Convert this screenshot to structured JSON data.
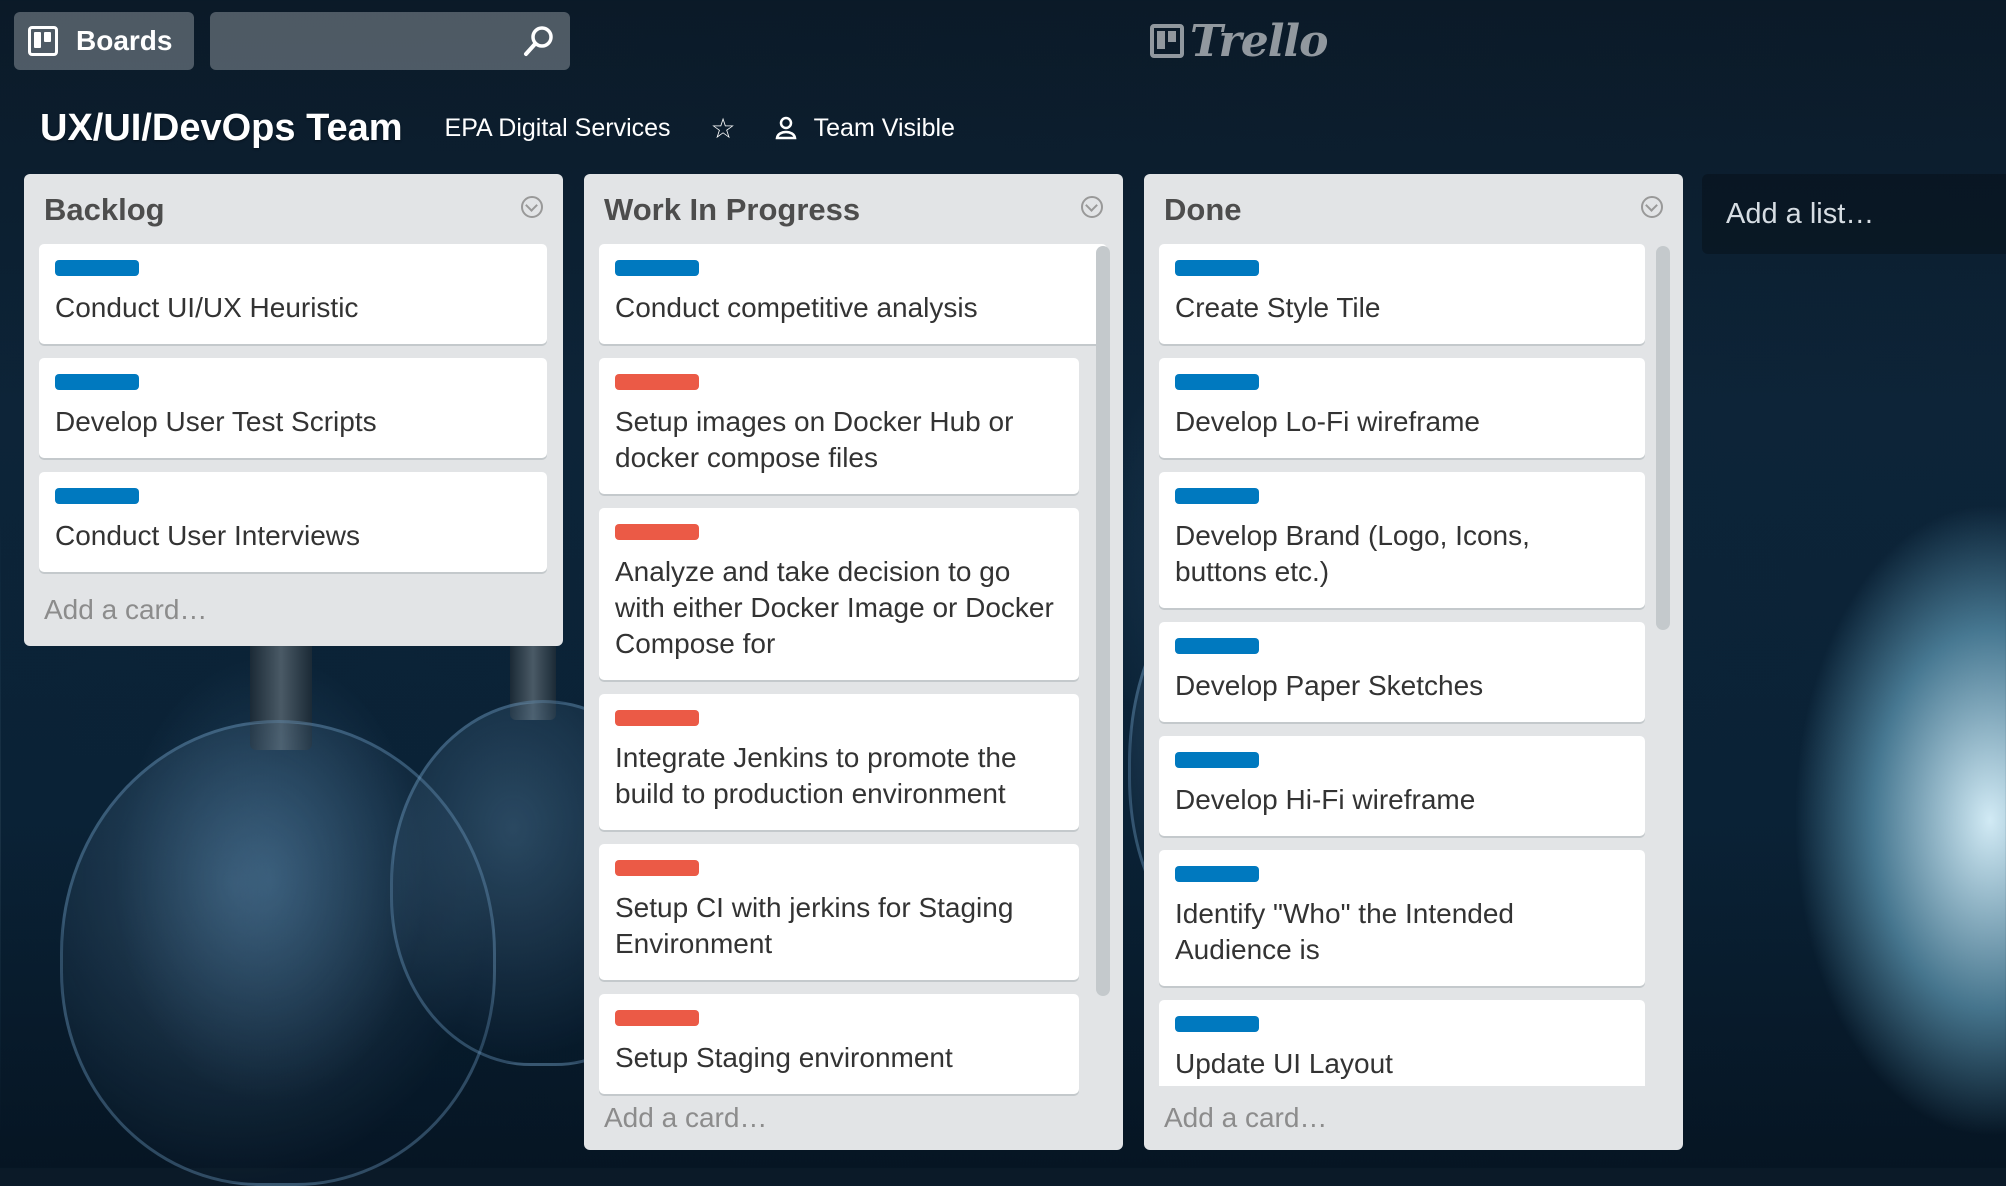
{
  "header": {
    "boards_label": "Boards",
    "search_placeholder": "",
    "logo_text": "Trello"
  },
  "board": {
    "title": "UX/UI/DevOps Team",
    "organization": "EPA Digital Services",
    "star_icon": "☆",
    "visibility": "Team Visible"
  },
  "lists": [
    {
      "title": "Backlog",
      "add_card": "Add a card…",
      "cards": [
        {
          "label": "blue",
          "text": "Conduct UI/UX Heuristic"
        },
        {
          "label": "blue",
          "text": "Develop User Test Scripts"
        },
        {
          "label": "blue",
          "text": "Conduct User Interviews"
        }
      ]
    },
    {
      "title": "Work In Progress",
      "add_card": "Add a card…",
      "cards": [
        {
          "label": "blue",
          "text": "Conduct competitive analysis"
        },
        {
          "label": "red",
          "text": "Setup images on Docker Hub or docker compose files"
        },
        {
          "label": "red",
          "text": "Analyze and take decision to go with either Docker Image or Docker Compose for"
        },
        {
          "label": "red",
          "text": "Integrate Jenkins to promote the build to production environment"
        },
        {
          "label": "red",
          "text": "Setup CI with jerkins for Staging Environment"
        },
        {
          "label": "red",
          "text": "Setup Staging environment"
        }
      ]
    },
    {
      "title": "Done",
      "add_card": "Add a card…",
      "cards": [
        {
          "label": "blue",
          "text": "Create Style Tile"
        },
        {
          "label": "blue",
          "text": "Develop Lo-Fi wireframe"
        },
        {
          "label": "blue",
          "text": "Develop Brand (Logo, Icons, buttons etc.)"
        },
        {
          "label": "blue",
          "text": "Develop Paper Sketches"
        },
        {
          "label": "blue",
          "text": "Develop Hi-Fi wireframe"
        },
        {
          "label": "blue",
          "text": "Identify \"Who\" the Intended Audience is"
        },
        {
          "label": "blue",
          "text": "Update UI Layout"
        }
      ]
    }
  ],
  "add_list": "Add a list…",
  "colors": {
    "label_blue": "#0079bf",
    "label_red": "#eb5a46",
    "list_bg": "#e2e4e6"
  }
}
